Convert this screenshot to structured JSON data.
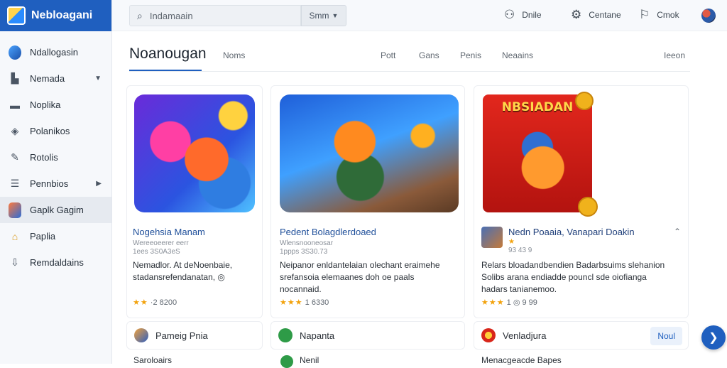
{
  "brand": {
    "name": "Nebloagani"
  },
  "sidebar": {
    "items": [
      {
        "label": "Ndallogasin",
        "icon": "app-icon",
        "arrow": ""
      },
      {
        "label": "Nemada",
        "icon": "chart-icon",
        "arrow": "▼"
      },
      {
        "label": "Noplika",
        "icon": "window-icon",
        "arrow": ""
      },
      {
        "label": "Polanikos",
        "icon": "tag-icon",
        "arrow": ""
      },
      {
        "label": "Rotolis",
        "icon": "wrench-icon",
        "arrow": ""
      },
      {
        "label": "Pennbios",
        "icon": "list-icon",
        "arrow": "▶"
      },
      {
        "label": "Gaplk Gagim",
        "icon": "game-icon",
        "arrow": ""
      },
      {
        "label": "Paplia",
        "icon": "building-icon",
        "arrow": ""
      },
      {
        "label": "Remdaldains",
        "icon": "download-icon",
        "arrow": ""
      }
    ]
  },
  "topbar": {
    "search_value": "Indamaain",
    "select_value": "Smm",
    "actions": [
      {
        "label": "Dnile",
        "icon": "people-icon"
      },
      {
        "label": "Centane",
        "icon": "settings-icon"
      },
      {
        "label": "Cmok",
        "icon": "bookmark-icon"
      }
    ]
  },
  "main": {
    "title": "Noanougan",
    "tabs": [
      "Noms",
      "Pott",
      "Gans",
      "Penis",
      "Neaains",
      "Ieeon"
    ]
  },
  "cards": [
    {
      "title": "Nogehsia Manam",
      "sub1": "Wereeoeerer eerr",
      "sub2": "1ees 3S0A3eS",
      "desc": "Nemadlor. At deNoenbaie,\nstadansrefendanatan, ◎",
      "stars": "★★",
      "rating": "·2 8200"
    },
    {
      "title": "Pedent Bolagdlerdoaed",
      "sub1": "Wlensnooneosar",
      "sub2": "1ppps 3S30.73",
      "desc": "Neipanor enldantelaian olechant eraimehe\nsrefansoia elemaanes doh oe paals\nnocannaid.",
      "stars": "★★★",
      "rating": "1 6330"
    },
    {
      "title": "Nedn Poaaia, Vanapari Doakin",
      "sub1": "★",
      "sub2": "93 43 9",
      "desc": "Relars bloadandbendien Badarbsuims slehanion\nSolibs arana endiadde pouncl sde oiofianga\nhadars tanianemoo.",
      "stars": "★★★",
      "rating": "1 ◎ 9 99"
    }
  ],
  "bottom_cards": [
    {
      "label": "Pameig Pnia",
      "button": ""
    },
    {
      "label": "Napanta",
      "button": ""
    },
    {
      "label": "Venladjura",
      "button": "Noul"
    }
  ],
  "bottom_texts": [
    "Saroloairs",
    "Nenil",
    "Menacgeacde Bapes"
  ],
  "art_headline": "NBSIADAN"
}
